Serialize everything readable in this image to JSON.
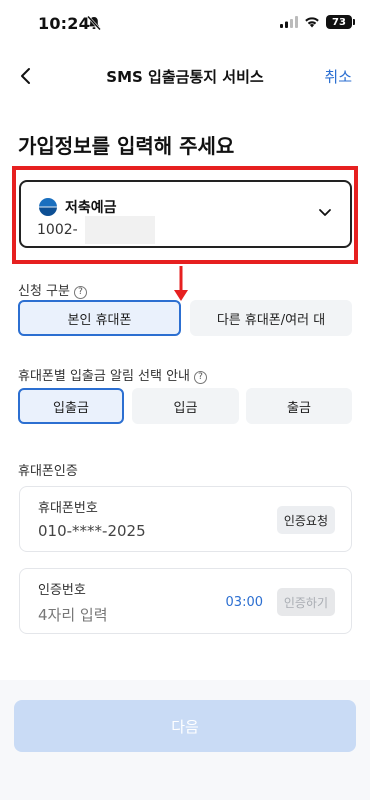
{
  "status": {
    "time": "10:24",
    "battery": "73"
  },
  "nav": {
    "title": "SMS 입출금통지 서비스",
    "cancel": "취소"
  },
  "page_title": "가입정보를 입력해 주세요",
  "account": {
    "name": "저축예금",
    "number_prefix": "1002-"
  },
  "apply_type": {
    "label": "신청 구분",
    "options": [
      "본인 휴대폰",
      "다른 휴대폰/여러 대"
    ],
    "selected": "본인 휴대폰"
  },
  "alert_type": {
    "label": "휴대폰별 입출금 알림 선택 안내",
    "options": [
      "입출금",
      "입금",
      "출금"
    ],
    "selected": "입출금"
  },
  "phone_auth": {
    "label": "휴대폰인증",
    "phone_label": "휴대폰번호",
    "phone_value": "010-****-2025",
    "request_button": "인증요청",
    "code_label": "인증번호",
    "code_placeholder": "4자리 입력",
    "timer": "03:00",
    "verify_button": "인증하기"
  },
  "next_button": "다음",
  "colors": {
    "accent": "#2c6fd1",
    "highlight": "#e62020"
  }
}
